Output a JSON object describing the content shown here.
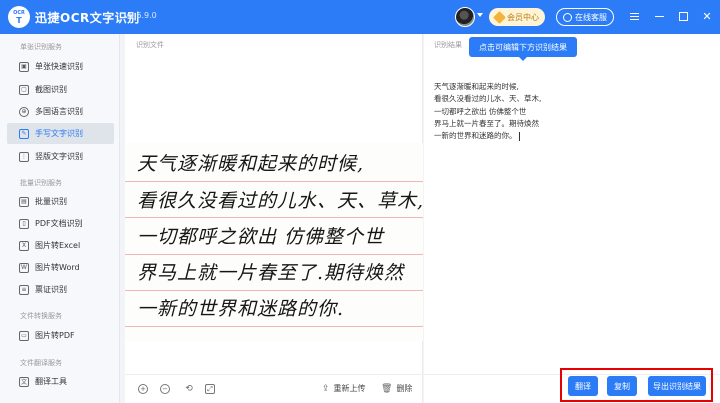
{
  "app": {
    "logo_top": "OCR",
    "logo_main": "T",
    "title": "迅捷OCR文字识别",
    "version": "v8.6.9.0",
    "vip_label": "会员中心",
    "service_label": "在线客服"
  },
  "sidebar": {
    "groups": [
      {
        "title": "单张识别服务",
        "items": [
          "单张快速识别",
          "截图识别",
          "多国语言识别",
          "手写文字识别",
          "竖版文字识别"
        ]
      },
      {
        "title": "批量识别服务",
        "items": [
          "批量识别",
          "PDF文档识别",
          "图片转Excel",
          "图片转Word",
          "票证识别"
        ]
      },
      {
        "title": "文件转换服务",
        "items": [
          "图片转PDF"
        ]
      },
      {
        "title": "文件翻译服务",
        "items": [
          "翻译工具"
        ]
      }
    ],
    "active_item": "手写文字识别"
  },
  "left_panel": {
    "label": "识别文件",
    "handwriting_lines": [
      "天气逐渐暖和起来的时候,",
      "看很久没看过的儿水、天、草木,",
      "一切都呼之欲出 仿佛整个世",
      "界马上就一片春至了.期待焕然",
      "一新的世界和迷路的你."
    ],
    "toolbar": {
      "reupload_label": "重新上传",
      "delete_label": "删除"
    }
  },
  "right_panel": {
    "label": "识别结果",
    "tooltip": "点击可编辑下方识别结果",
    "result_lines": [
      "天气逐渐暖和起来的时候,",
      "看很久没看过的儿水、天、草木,",
      "一切都呼之欲出 仿佛整个世",
      "界马上就一片春至了。期待焕然",
      "一新的世界和迷路的你。"
    ],
    "buttons": {
      "translate": "翻译",
      "copy": "复制",
      "export": "导出识别结果"
    }
  },
  "colors": {
    "accent": "#2b7cf6",
    "highlight_frame": "#e60000"
  }
}
